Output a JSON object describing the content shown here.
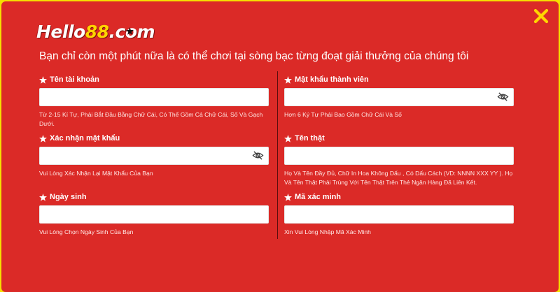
{
  "logo": {
    "text_main": "Hello",
    "text_num": "88",
    "text_tld": ".com"
  },
  "headline": "Bạn chỉ còn một phút nữa là có thể chơi tại sòng bạc từng đoạt giải thưởng của chúng tôi",
  "fields": {
    "username": {
      "label": "Tên tài khoản",
      "value": "",
      "hint": "Từ 2-15 Kí Tự, Phải Bắt Đầu Bằng Chữ Cái, Có Thể Gồm Cả Chữ Cái, Số Và Gạch Dưới."
    },
    "password": {
      "label": "Mật khẩu thành viên",
      "value": "",
      "hint": "Hơn 6 Ký Tự Phải Bao Gồm Chữ Cái Và Số"
    },
    "confirm_password": {
      "label": "Xác nhận mật khẩu",
      "value": "",
      "hint": "Vui Lòng Xác Nhận Lại Mật Khẩu Của Bạn"
    },
    "real_name": {
      "label": "Tên thật",
      "value": "",
      "hint": "Họ Và Tên Đầy Đủ, Chữ In Hoa Không Dấu , Có Dấu Cách (VD: NNNN XXX YY ). Họ Và Tên Thật Phải Trùng Với Tên Thật Trên Thẻ Ngân Hàng Đã Liên Kết."
    },
    "birthday": {
      "label": "Ngày sinh",
      "value": "",
      "hint": "Vui Lòng Chọn Ngày Sinh Của Bạn"
    },
    "captcha": {
      "label": "Mã xác minh",
      "value": "",
      "hint": "Xin Vui Lòng Nhập Mã Xác Minh"
    }
  },
  "icons": {
    "close": "close-icon",
    "star": "star-icon",
    "eye": "eye-slash-icon"
  },
  "colors": {
    "background": "#db2a27",
    "frame": "#f6df00",
    "accent": "#ffd400",
    "text": "#ffffff"
  }
}
